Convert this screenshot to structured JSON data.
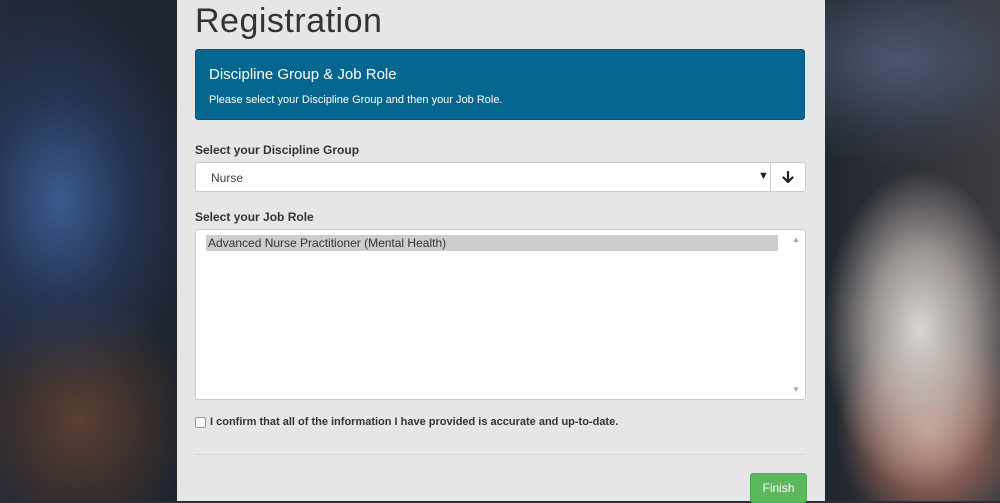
{
  "page": {
    "title": "Registration"
  },
  "info_box": {
    "heading": "Discipline Group & Job Role",
    "text": "Please select your Discipline Group and then your Job Role."
  },
  "discipline": {
    "label": "Select your Discipline Group",
    "selected": "Nurse",
    "caret": "▼",
    "addon_icon": "arrow-down-icon",
    "addon_glyph": "🡫"
  },
  "job_role": {
    "label": "Select your Job Role",
    "options": [
      "Advanced Nurse Practitioner (Mental Health)"
    ],
    "scroll_up": "▲",
    "scroll_down": "▼"
  },
  "confirm": {
    "text": "I confirm that all of the information I have provided is accurate and up-to-date.",
    "checked": false
  },
  "actions": {
    "finish_label": "Finish"
  },
  "colors": {
    "info_box_bg": "#05668f",
    "finish_bg": "#5cb85c",
    "panel_bg": "#e6e6e6"
  }
}
